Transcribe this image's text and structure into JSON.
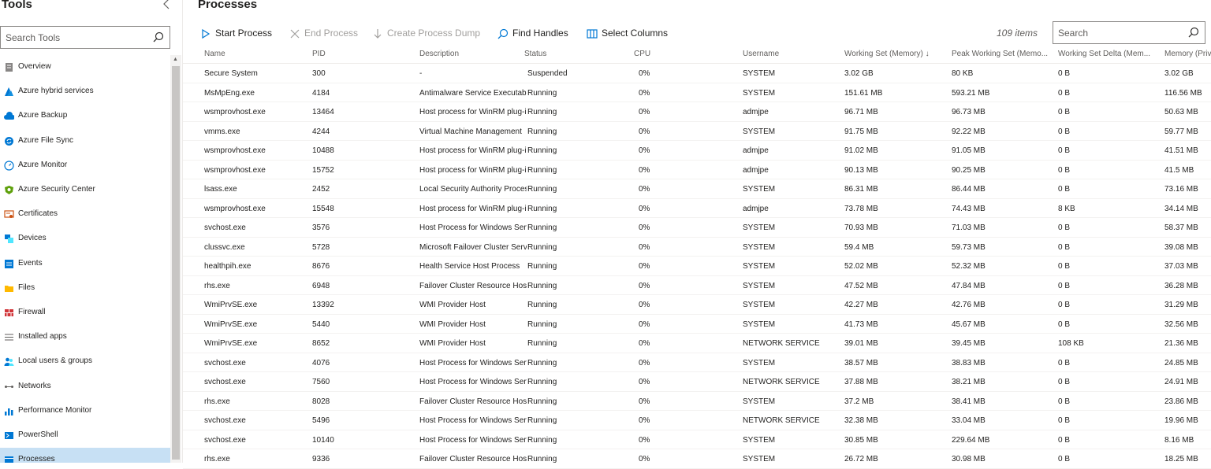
{
  "sidebar": {
    "title": "Tools",
    "collapse_icon": "chevron-left-icon",
    "search_placeholder": "Search Tools",
    "items": [
      {
        "label": "Overview",
        "icon": "overview-icon",
        "color": "#605e5c",
        "active": false
      },
      {
        "label": "Azure hybrid services",
        "icon": "azure-icon",
        "color": "#0078d4",
        "active": false
      },
      {
        "label": "Azure Backup",
        "icon": "cloud-backup-icon",
        "color": "#0078d4",
        "active": false
      },
      {
        "label": "Azure File Sync",
        "icon": "file-sync-icon",
        "color": "#0078d4",
        "active": false
      },
      {
        "label": "Azure Monitor",
        "icon": "monitor-gauge-icon",
        "color": "#0078d4",
        "active": false
      },
      {
        "label": "Azure Security Center",
        "icon": "shield-icon",
        "color": "#5ea00b",
        "active": false
      },
      {
        "label": "Certificates",
        "icon": "certificate-icon",
        "color": "#ca5010",
        "active": false
      },
      {
        "label": "Devices",
        "icon": "devices-icon",
        "color": "#0078d4",
        "active": false
      },
      {
        "label": "Events",
        "icon": "events-icon",
        "color": "#0078d4",
        "active": false
      },
      {
        "label": "Files",
        "icon": "folder-icon",
        "color": "#ffb900",
        "active": false
      },
      {
        "label": "Firewall",
        "icon": "firewall-icon",
        "color": "#d13438",
        "active": false
      },
      {
        "label": "Installed apps",
        "icon": "list-icon",
        "color": "#605e5c",
        "active": false
      },
      {
        "label": "Local users & groups",
        "icon": "users-icon",
        "color": "#0078d4",
        "active": false
      },
      {
        "label": "Networks",
        "icon": "network-icon",
        "color": "#605e5c",
        "active": false
      },
      {
        "label": "Performance Monitor",
        "icon": "bar-chart-icon",
        "color": "#0078d4",
        "active": false
      },
      {
        "label": "PowerShell",
        "icon": "powershell-icon",
        "color": "#0078d4",
        "active": false
      },
      {
        "label": "Processes",
        "icon": "processes-icon",
        "color": "#0078d4",
        "active": true
      }
    ]
  },
  "main": {
    "title": "Processes",
    "toolbar": {
      "start_process": "Start Process",
      "end_process": "End Process",
      "create_dump": "Create Process Dump",
      "find_handles": "Find Handles",
      "select_columns": "Select Columns"
    },
    "item_count": "109 items",
    "search_placeholder": "Search",
    "columns": [
      "Name",
      "PID",
      "Description",
      "Status",
      "CPU",
      "Username",
      "Working Set (Memory) ↓",
      "Peak Working Set (Memo...",
      "Working Set Delta (Mem...",
      "Memory (Priva"
    ],
    "rows": [
      [
        "Secure System",
        "300",
        "-",
        "Suspended",
        "0%",
        "SYSTEM",
        "3.02 GB",
        "80 KB",
        "0 B",
        "3.02 GB"
      ],
      [
        "MsMpEng.exe",
        "4184",
        "Antimalware Service Executable",
        "Running",
        "0%",
        "SYSTEM",
        "151.61 MB",
        "593.21 MB",
        "0 B",
        "116.56 MB"
      ],
      [
        "wsmprovhost.exe",
        "13464",
        "Host process for WinRM plug-ins",
        "Running",
        "0%",
        "admjpe",
        "96.71 MB",
        "96.73 MB",
        "0 B",
        "50.63 MB"
      ],
      [
        "vmms.exe",
        "4244",
        "Virtual Machine Management",
        "Running",
        "0%",
        "SYSTEM",
        "91.75 MB",
        "92.22 MB",
        "0 B",
        "59.77 MB"
      ],
      [
        "wsmprovhost.exe",
        "10488",
        "Host process for WinRM plug-ins",
        "Running",
        "0%",
        "admjpe",
        "91.02 MB",
        "91.05 MB",
        "0 B",
        "41.51 MB"
      ],
      [
        "wsmprovhost.exe",
        "15752",
        "Host process for WinRM plug-ins",
        "Running",
        "0%",
        "admjpe",
        "90.13 MB",
        "90.25 MB",
        "0 B",
        "41.5 MB"
      ],
      [
        "lsass.exe",
        "2452",
        "Local Security Authority Process",
        "Running",
        "0%",
        "SYSTEM",
        "86.31 MB",
        "86.44 MB",
        "0 B",
        "73.16 MB"
      ],
      [
        "wsmprovhost.exe",
        "15548",
        "Host process for WinRM plug-ins",
        "Running",
        "0%",
        "admjpe",
        "73.78 MB",
        "74.43 MB",
        "8 KB",
        "34.14 MB"
      ],
      [
        "svchost.exe",
        "3576",
        "Host Process for Windows Services",
        "Running",
        "0%",
        "SYSTEM",
        "70.93 MB",
        "71.03 MB",
        "0 B",
        "58.37 MB"
      ],
      [
        "clussvc.exe",
        "5728",
        "Microsoft Failover Cluster Service",
        "Running",
        "0%",
        "SYSTEM",
        "59.4 MB",
        "59.73 MB",
        "0 B",
        "39.08 MB"
      ],
      [
        "healthpih.exe",
        "8676",
        "Health Service Host Process",
        "Running",
        "0%",
        "SYSTEM",
        "52.02 MB",
        "52.32 MB",
        "0 B",
        "37.03 MB"
      ],
      [
        "rhs.exe",
        "6948",
        "Failover Cluster Resource Host",
        "Running",
        "0%",
        "SYSTEM",
        "47.52 MB",
        "47.84 MB",
        "0 B",
        "36.28 MB"
      ],
      [
        "WmiPrvSE.exe",
        "13392",
        "WMI Provider Host",
        "Running",
        "0%",
        "SYSTEM",
        "42.27 MB",
        "42.76 MB",
        "0 B",
        "31.29 MB"
      ],
      [
        "WmiPrvSE.exe",
        "5440",
        "WMI Provider Host",
        "Running",
        "0%",
        "SYSTEM",
        "41.73 MB",
        "45.67 MB",
        "0 B",
        "32.56 MB"
      ],
      [
        "WmiPrvSE.exe",
        "8652",
        "WMI Provider Host",
        "Running",
        "0%",
        "NETWORK SERVICE",
        "39.01 MB",
        "39.45 MB",
        "108 KB",
        "21.36 MB"
      ],
      [
        "svchost.exe",
        "4076",
        "Host Process for Windows Services",
        "Running",
        "0%",
        "SYSTEM",
        "38.57 MB",
        "38.83 MB",
        "0 B",
        "24.85 MB"
      ],
      [
        "svchost.exe",
        "7560",
        "Host Process for Windows Services",
        "Running",
        "0%",
        "NETWORK SERVICE",
        "37.88 MB",
        "38.21 MB",
        "0 B",
        "24.91 MB"
      ],
      [
        "rhs.exe",
        "8028",
        "Failover Cluster Resource Host",
        "Running",
        "0%",
        "SYSTEM",
        "37.2 MB",
        "38.41 MB",
        "0 B",
        "23.86 MB"
      ],
      [
        "svchost.exe",
        "5496",
        "Host Process for Windows Services",
        "Running",
        "0%",
        "NETWORK SERVICE",
        "32.38 MB",
        "33.04 MB",
        "0 B",
        "19.96 MB"
      ],
      [
        "svchost.exe",
        "10140",
        "Host Process for Windows Services",
        "Running",
        "0%",
        "SYSTEM",
        "30.85 MB",
        "229.64 MB",
        "0 B",
        "8.16 MB"
      ],
      [
        "rhs.exe",
        "9336",
        "Failover Cluster Resource Host",
        "Running",
        "0%",
        "SYSTEM",
        "26.72 MB",
        "30.98 MB",
        "0 B",
        "18.25 MB"
      ]
    ]
  }
}
